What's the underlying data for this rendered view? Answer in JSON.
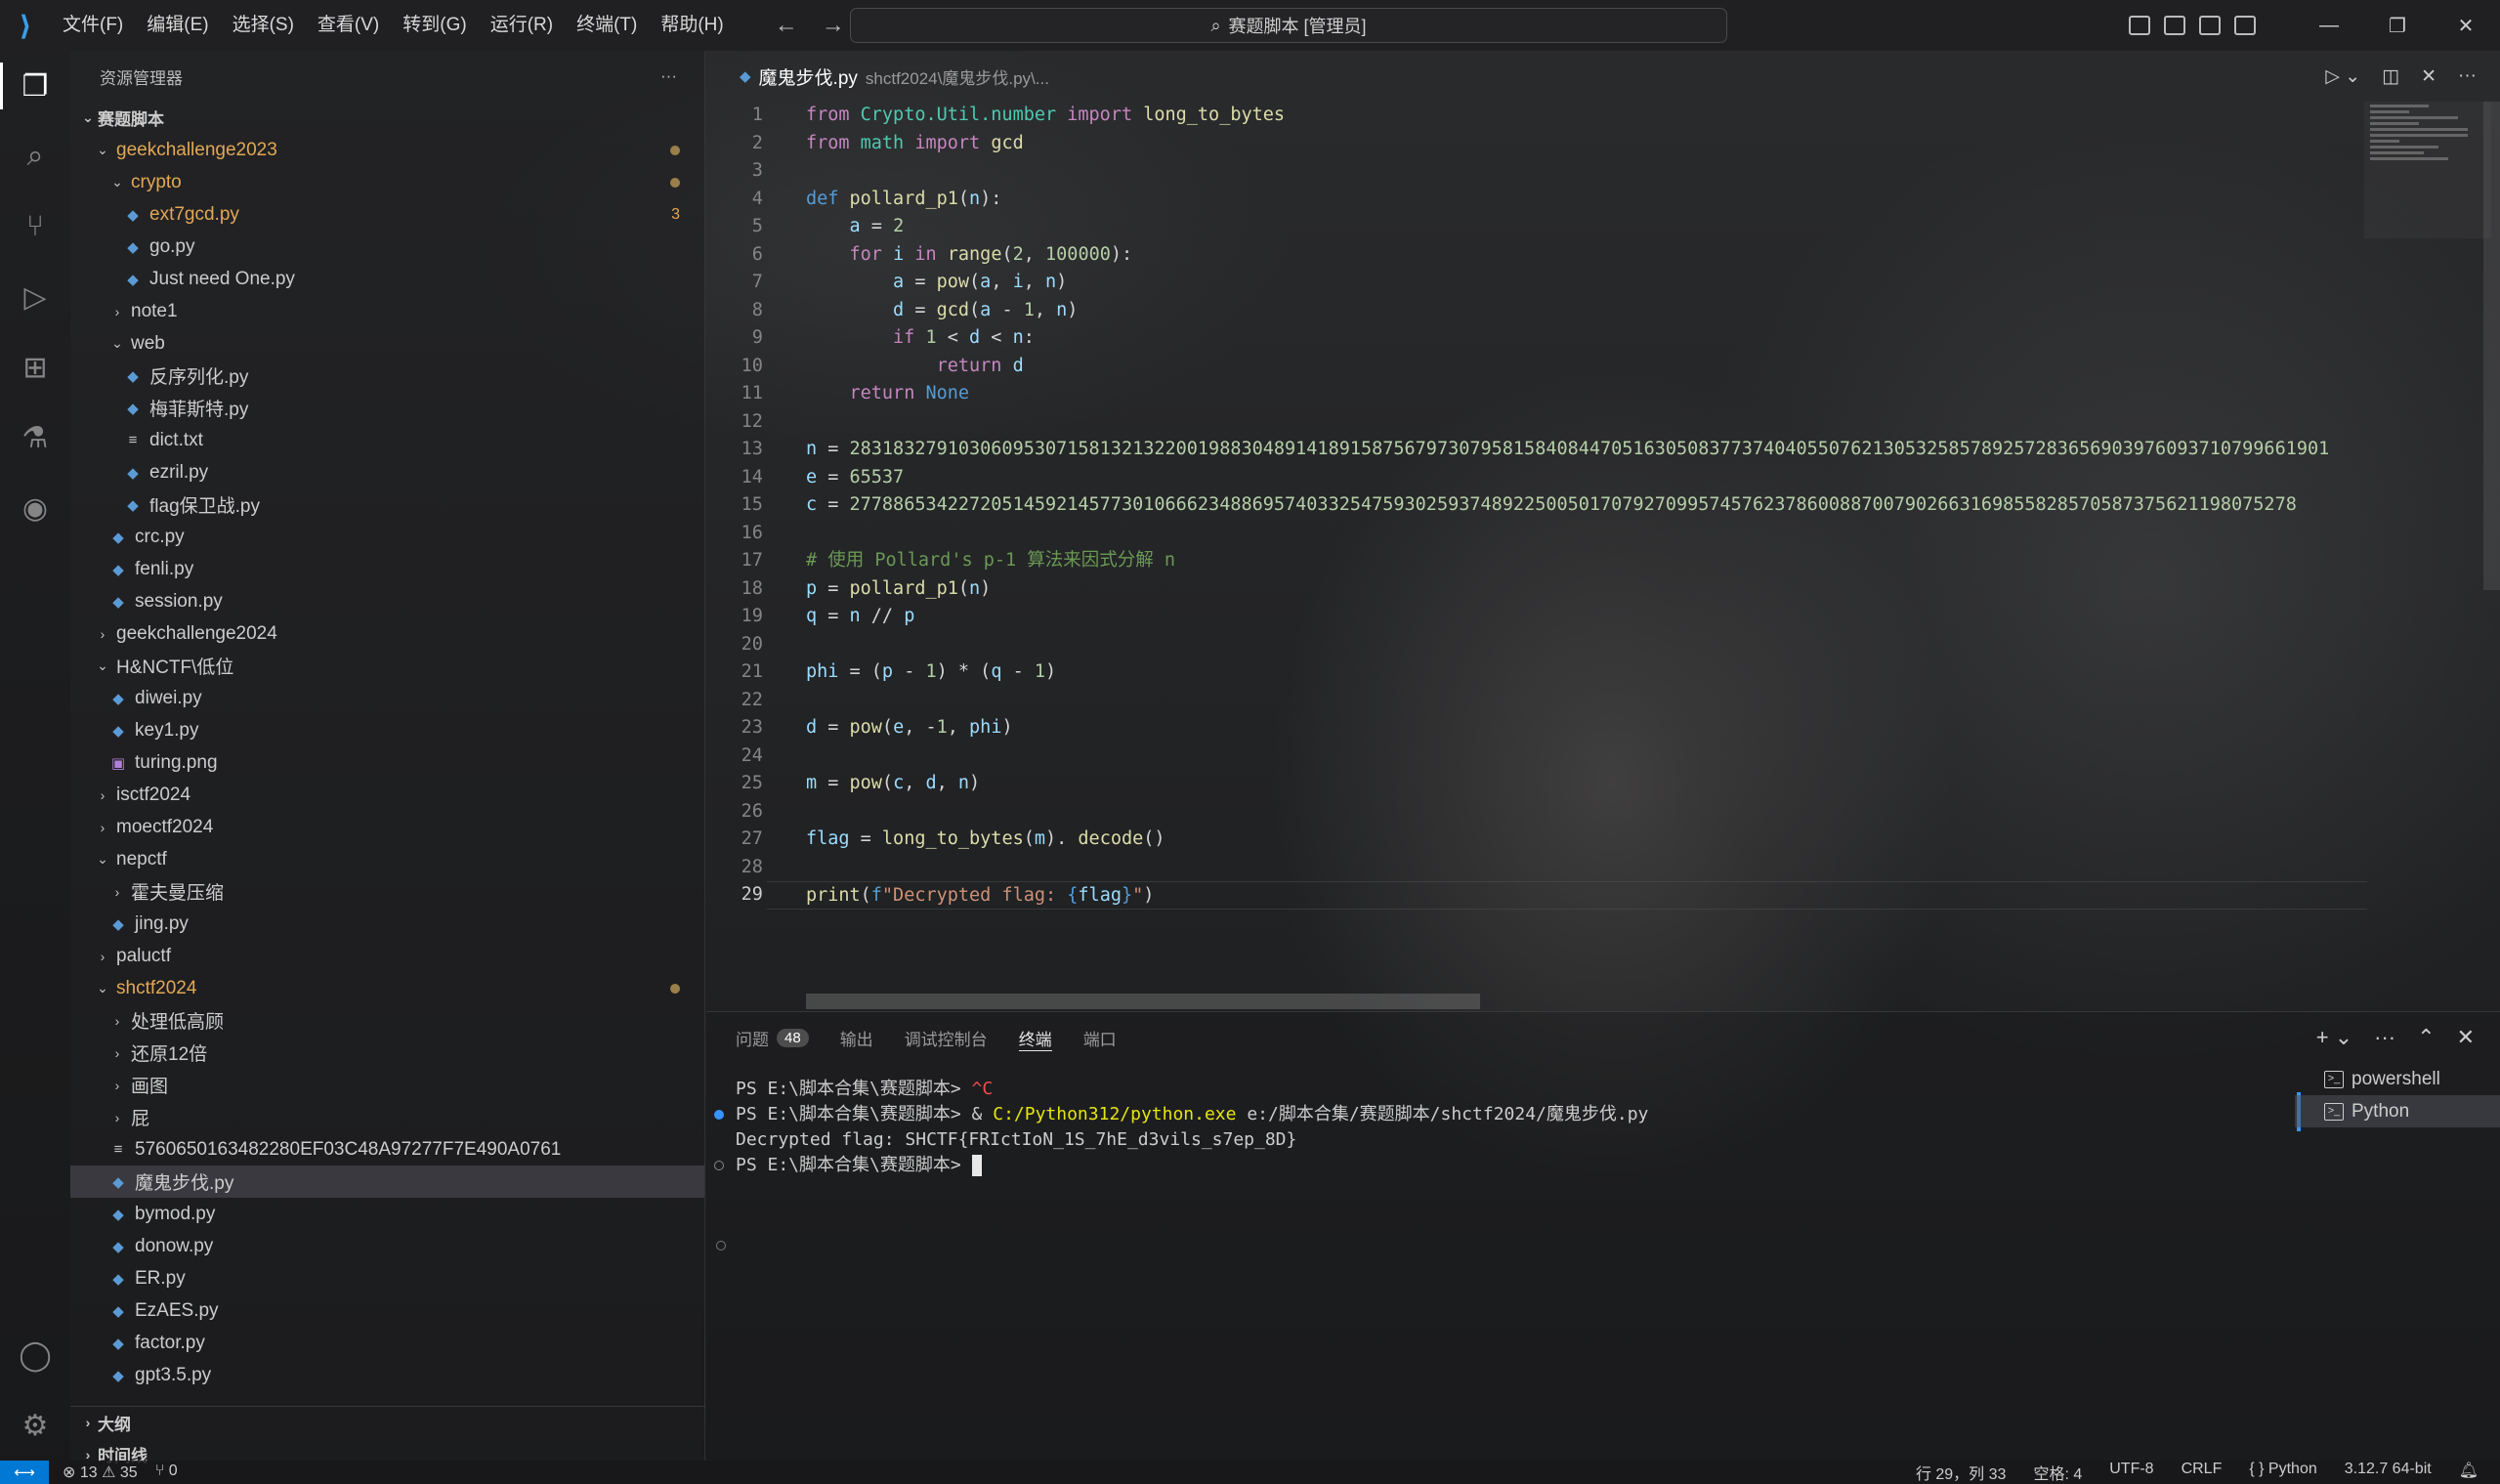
{
  "titlebar": {
    "menu": [
      "文件(F)",
      "编辑(E)",
      "选择(S)",
      "查看(V)",
      "转到(G)",
      "运行(R)",
      "终端(T)",
      "帮助(H)"
    ],
    "search": "赛题脚本 [管理员]"
  },
  "sidebar": {
    "title": "资源管理器",
    "root": "赛题脚本",
    "outline": "大纲",
    "timeline": "时间线",
    "tree": [
      {
        "label": "geekchallenge2023",
        "depth": 1,
        "kind": "folder-open",
        "modified": true,
        "dot": true
      },
      {
        "label": "crypto",
        "depth": 2,
        "kind": "folder-open",
        "modified": true,
        "dot": true
      },
      {
        "label": "ext7gcd.py",
        "depth": 3,
        "kind": "py",
        "modified": true,
        "badge": "3"
      },
      {
        "label": "go.py",
        "depth": 3,
        "kind": "py"
      },
      {
        "label": "Just need One.py",
        "depth": 3,
        "kind": "py"
      },
      {
        "label": "note1",
        "depth": 2,
        "kind": "folder"
      },
      {
        "label": "web",
        "depth": 2,
        "kind": "folder-open"
      },
      {
        "label": "反序列化.py",
        "depth": 3,
        "kind": "py"
      },
      {
        "label": "梅菲斯特.py",
        "depth": 3,
        "kind": "py"
      },
      {
        "label": "dict.txt",
        "depth": 3,
        "kind": "txt"
      },
      {
        "label": "ezril.py",
        "depth": 3,
        "kind": "py"
      },
      {
        "label": "flag保卫战.py",
        "depth": 3,
        "kind": "py"
      },
      {
        "label": "crc.py",
        "depth": 2,
        "kind": "py"
      },
      {
        "label": "fenli.py",
        "depth": 2,
        "kind": "py"
      },
      {
        "label": "session.py",
        "depth": 2,
        "kind": "py"
      },
      {
        "label": "geekchallenge2024",
        "depth": 1,
        "kind": "folder"
      },
      {
        "label": "H&NCTF\\低位",
        "depth": 1,
        "kind": "folder-open"
      },
      {
        "label": "diwei.py",
        "depth": 2,
        "kind": "py"
      },
      {
        "label": "key1.py",
        "depth": 2,
        "kind": "py"
      },
      {
        "label": "turing.png",
        "depth": 2,
        "kind": "img"
      },
      {
        "label": "isctf2024",
        "depth": 1,
        "kind": "folder"
      },
      {
        "label": "moectf2024",
        "depth": 1,
        "kind": "folder"
      },
      {
        "label": "nepctf",
        "depth": 1,
        "kind": "folder-open"
      },
      {
        "label": "霍夫曼压缩",
        "depth": 2,
        "kind": "folder"
      },
      {
        "label": "jing.py",
        "depth": 2,
        "kind": "py"
      },
      {
        "label": "paluctf",
        "depth": 1,
        "kind": "folder"
      },
      {
        "label": "shctf2024",
        "depth": 1,
        "kind": "folder-open",
        "modified": true,
        "dot": true
      },
      {
        "label": "处理低高顾",
        "depth": 2,
        "kind": "folder"
      },
      {
        "label": "还原12倍",
        "depth": 2,
        "kind": "folder"
      },
      {
        "label": "画图",
        "depth": 2,
        "kind": "folder"
      },
      {
        "label": "屁",
        "depth": 2,
        "kind": "folder"
      },
      {
        "label": "5760650163482280EF03C48A97277F7E490A0761",
        "depth": 2,
        "kind": "txt"
      },
      {
        "label": "魔鬼步伐.py",
        "depth": 2,
        "kind": "py",
        "selected": true
      },
      {
        "label": "bymod.py",
        "depth": 2,
        "kind": "py"
      },
      {
        "label": "donow.py",
        "depth": 2,
        "kind": "py"
      },
      {
        "label": "ER.py",
        "depth": 2,
        "kind": "py"
      },
      {
        "label": "EzAES.py",
        "depth": 2,
        "kind": "py"
      },
      {
        "label": "factor.py",
        "depth": 2,
        "kind": "py"
      },
      {
        "label": "gpt3.5.py",
        "depth": 2,
        "kind": "py"
      }
    ]
  },
  "editor": {
    "tab_name": "魔鬼步伐.py",
    "tab_path": "shctf2024\\魔鬼步伐.py\\...",
    "current_line": 29,
    "lines": [
      [
        [
          "kw",
          "from "
        ],
        [
          "ty",
          "Crypto.Util.number "
        ],
        [
          "kw",
          "import "
        ],
        [
          "fn",
          "long_to_bytes"
        ]
      ],
      [
        [
          "kw",
          "from "
        ],
        [
          "ty",
          "math "
        ],
        [
          "kw",
          "import "
        ],
        [
          "fn",
          "gcd"
        ]
      ],
      [],
      [
        [
          "kb",
          "def "
        ],
        [
          "fn",
          "pollard_p1"
        ],
        [
          "",
          "("
        ],
        [
          "vr",
          "n"
        ],
        [
          "",
          "):"
        ]
      ],
      [
        [
          "",
          "    "
        ],
        [
          "vr",
          "a"
        ],
        [
          "",
          " = "
        ],
        [
          "nm",
          "2"
        ]
      ],
      [
        [
          "",
          "    "
        ],
        [
          "kw",
          "for "
        ],
        [
          "vr",
          "i "
        ],
        [
          "kw",
          "in "
        ],
        [
          "fn",
          "range"
        ],
        [
          "",
          "("
        ],
        [
          "nm",
          "2"
        ],
        [
          "",
          ", "
        ],
        [
          "nm",
          "100000"
        ],
        [
          "",
          "):"
        ]
      ],
      [
        [
          "",
          "        "
        ],
        [
          "vr",
          "a"
        ],
        [
          "",
          " = "
        ],
        [
          "fn",
          "pow"
        ],
        [
          "",
          "("
        ],
        [
          "vr",
          "a"
        ],
        [
          "",
          ", "
        ],
        [
          "vr",
          "i"
        ],
        [
          "",
          ", "
        ],
        [
          "vr",
          "n"
        ],
        [
          "",
          ")"
        ]
      ],
      [
        [
          "",
          "        "
        ],
        [
          "vr",
          "d"
        ],
        [
          "",
          " = "
        ],
        [
          "fn",
          "gcd"
        ],
        [
          "",
          "("
        ],
        [
          "vr",
          "a"
        ],
        [
          "",
          " - "
        ],
        [
          "nm",
          "1"
        ],
        [
          "",
          ", "
        ],
        [
          "vr",
          "n"
        ],
        [
          "",
          ")"
        ]
      ],
      [
        [
          "",
          "        "
        ],
        [
          "kw",
          "if "
        ],
        [
          "nm",
          "1"
        ],
        [
          "",
          " < "
        ],
        [
          "vr",
          "d"
        ],
        [
          "",
          " < "
        ],
        [
          "vr",
          "n"
        ],
        [
          "",
          ":"
        ]
      ],
      [
        [
          "",
          "            "
        ],
        [
          "kw",
          "return "
        ],
        [
          "vr",
          "d"
        ]
      ],
      [
        [
          "",
          "    "
        ],
        [
          "kw",
          "return "
        ],
        [
          "kb",
          "None"
        ]
      ],
      [],
      [
        [
          "vr",
          "n"
        ],
        [
          "",
          " = "
        ],
        [
          "nm",
          "2831832791030609530715813213220019883048914189158756797307958158408447051630508377374040550762130532585789257283656903976093710799661901"
        ]
      ],
      [
        [
          "vr",
          "e"
        ],
        [
          "",
          " = "
        ],
        [
          "nm",
          "65537"
        ]
      ],
      [
        [
          "vr",
          "c"
        ],
        [
          "",
          " = "
        ],
        [
          "nm",
          "2778865342272051459214577301066623488695740332547593025937489225005017079270995745762378600887007902663169855828570587375621198075278"
        ]
      ],
      [],
      [
        [
          "cm",
          "# 使用 Pollard's p-1 算法来因式分解 n"
        ]
      ],
      [
        [
          "vr",
          "p"
        ],
        [
          "",
          " = "
        ],
        [
          "fn",
          "pollard_p1"
        ],
        [
          "",
          "("
        ],
        [
          "vr",
          "n"
        ],
        [
          "",
          ")"
        ]
      ],
      [
        [
          "vr",
          "q"
        ],
        [
          "",
          " = "
        ],
        [
          "vr",
          "n"
        ],
        [
          "",
          " // "
        ],
        [
          "vr",
          "p"
        ]
      ],
      [],
      [
        [
          "vr",
          "phi"
        ],
        [
          "",
          " = ("
        ],
        [
          "vr",
          "p"
        ],
        [
          "",
          " - "
        ],
        [
          "nm",
          "1"
        ],
        [
          "",
          ") * ("
        ],
        [
          "vr",
          "q"
        ],
        [
          "",
          " - "
        ],
        [
          "nm",
          "1"
        ],
        [
          "",
          ")"
        ]
      ],
      [],
      [
        [
          "vr",
          "d"
        ],
        [
          "",
          " = "
        ],
        [
          "fn",
          "pow"
        ],
        [
          "",
          "("
        ],
        [
          "vr",
          "e"
        ],
        [
          "",
          ", -"
        ],
        [
          "nm",
          "1"
        ],
        [
          "",
          ", "
        ],
        [
          "vr",
          "phi"
        ],
        [
          "",
          ")"
        ]
      ],
      [],
      [
        [
          "vr",
          "m"
        ],
        [
          "",
          " = "
        ],
        [
          "fn",
          "pow"
        ],
        [
          "",
          "("
        ],
        [
          "vr",
          "c"
        ],
        [
          "",
          ", "
        ],
        [
          "vr",
          "d"
        ],
        [
          "",
          ", "
        ],
        [
          "vr",
          "n"
        ],
        [
          "",
          ")"
        ]
      ],
      [],
      [
        [
          "vr",
          "flag"
        ],
        [
          "",
          " = "
        ],
        [
          "fn",
          "long_to_bytes"
        ],
        [
          "",
          "("
        ],
        [
          "vr",
          "m"
        ],
        [
          "",
          "). "
        ],
        [
          "fn",
          "decode"
        ],
        [
          "",
          "()"
        ]
      ],
      [],
      [
        [
          "fn",
          "print"
        ],
        [
          "",
          "("
        ],
        [
          "kb",
          "f"
        ],
        [
          "st",
          "\"Decrypted flag: "
        ],
        [
          "kb",
          "{"
        ],
        [
          "vr",
          "flag"
        ],
        [
          "kb",
          "}"
        ],
        [
          "st",
          "\""
        ],
        [
          "",
          ")"
        ]
      ]
    ]
  },
  "panel": {
    "tabs": [
      {
        "label": "问题",
        "count": "48"
      },
      {
        "label": "输出"
      },
      {
        "label": "调试控制台"
      },
      {
        "label": "终端",
        "active": true
      },
      {
        "label": "端口"
      }
    ],
    "terminal": [
      {
        "prompt": "PS E:\\脚本合集\\赛题脚本> ",
        "ctrl": "^C"
      },
      {
        "prompt": "PS E:\\脚本合集\\赛题脚本> ",
        "cmd_pre": "& ",
        "exe": "C:/Python312/python.exe",
        "cmd_post": " e:/脚本合集/赛题脚本/shctf2024/魔鬼步伐.py",
        "marker": "blue"
      },
      {
        "text": "Decrypted flag: SHCTF{FRIctIoN_1S_7hE_d3vils_s7ep_8D}"
      },
      {
        "prompt": "PS E:\\脚本合集\\赛题脚本> ",
        "marker": "hollow",
        "cursor": true
      }
    ],
    "terminal_list": [
      "powershell",
      "Python"
    ]
  },
  "statusbar": {
    "errors": "13",
    "warnings": "35",
    "ports": "0",
    "position": "行 29，列 33",
    "spaces": "空格: 4",
    "encoding": "UTF-8",
    "eol": "CRLF",
    "language": "Python",
    "interpreter": "3.12.7 64-bit"
  }
}
